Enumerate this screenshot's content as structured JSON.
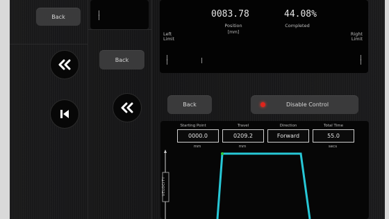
{
  "left_column": {
    "back_label_top": "Back",
    "back_label_mid": "Back"
  },
  "status": {
    "position_value": "0083.78",
    "position_label": "Position",
    "position_unit": "[mm]",
    "completed_value": "44.08%",
    "completed_label": "Completed",
    "left_limit": "Left\nLimit",
    "right_limit": "Right\nLimit"
  },
  "controls": {
    "back_label": "Back",
    "disable_label": "Disable Control",
    "indicator_color": "#e0241b"
  },
  "fields": {
    "starting_point_label": "Starting Point",
    "starting_point_value": "0000.0",
    "starting_point_unit": "mm",
    "travel_label": "Travel",
    "travel_value": "0209.2",
    "travel_unit": "mm",
    "direction_label": "Direction",
    "direction_value": "Forward",
    "total_time_label": "Total Time",
    "total_time_value": "55.0",
    "total_time_unit": "secs"
  },
  "profile_chart": {
    "y_axis_label": "VELOCITY",
    "line_color": "#27c7d6"
  },
  "icons": {
    "fast_rewind": "double-chevron-left-icon",
    "skip_start": "skip-to-start-icon"
  }
}
